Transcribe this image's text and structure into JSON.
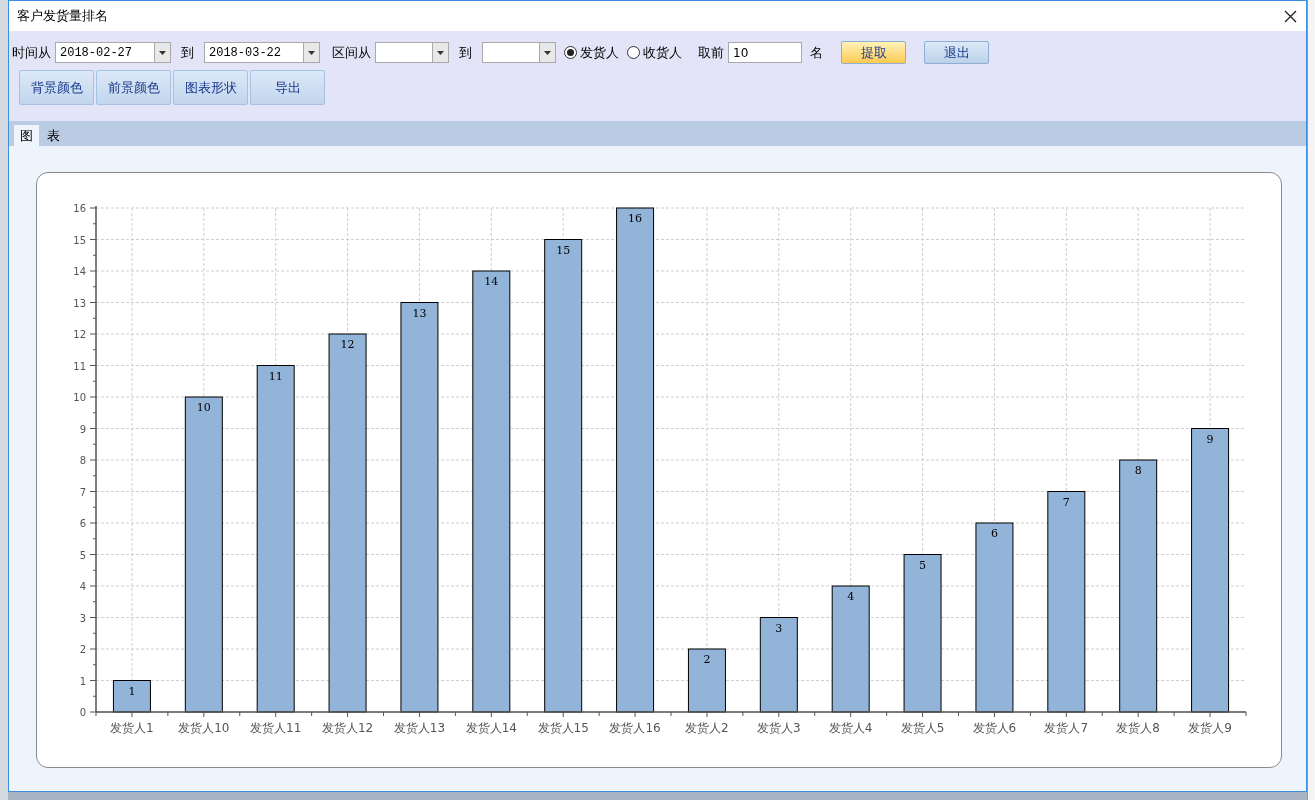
{
  "window": {
    "title": "客户发货量排名"
  },
  "filters": {
    "time_from_label": "时间从",
    "date_from": "2018-02-27",
    "to_label_1": "到",
    "date_to": "2018-03-22",
    "range_from_label": "区间从",
    "to_label_2": "到",
    "radios": [
      {
        "label": "发货人",
        "selected": true
      },
      {
        "label": "收货人",
        "selected": false
      }
    ],
    "top_label": "取前",
    "top_value": "10",
    "top_suffix": "名"
  },
  "action_buttons": [
    {
      "label": "提取",
      "kind": "primary"
    },
    {
      "label": "退出",
      "kind": "normal"
    }
  ],
  "toolbar_buttons": [
    "背景颜色",
    "前景颜色",
    "图表形状",
    "导出"
  ],
  "tabs": [
    {
      "label": "图",
      "selected": true
    },
    {
      "label": "表",
      "selected": false
    }
  ],
  "chart_data": {
    "type": "bar",
    "categories": [
      "发货人1",
      "发货人10",
      "发货人11",
      "发货人12",
      "发货人13",
      "发货人14",
      "发货人15",
      "发货人16",
      "发货人2",
      "发货人3",
      "发货人4",
      "发货人5",
      "发货人6",
      "发货人7",
      "发货人8",
      "发货人9"
    ],
    "series": [
      {
        "color": "#92b4d8",
        "values": [
          1,
          10,
          11,
          12,
          13,
          14,
          15,
          16,
          2,
          3,
          4,
          5,
          6,
          7,
          8,
          9
        ]
      }
    ],
    "ylim": [
      0,
      16
    ],
    "yticks": [
      0,
      1,
      2,
      3,
      4,
      5,
      6,
      7,
      8,
      9,
      10,
      11,
      12,
      13,
      14,
      15,
      16
    ],
    "data_labels": true,
    "grid": true
  }
}
